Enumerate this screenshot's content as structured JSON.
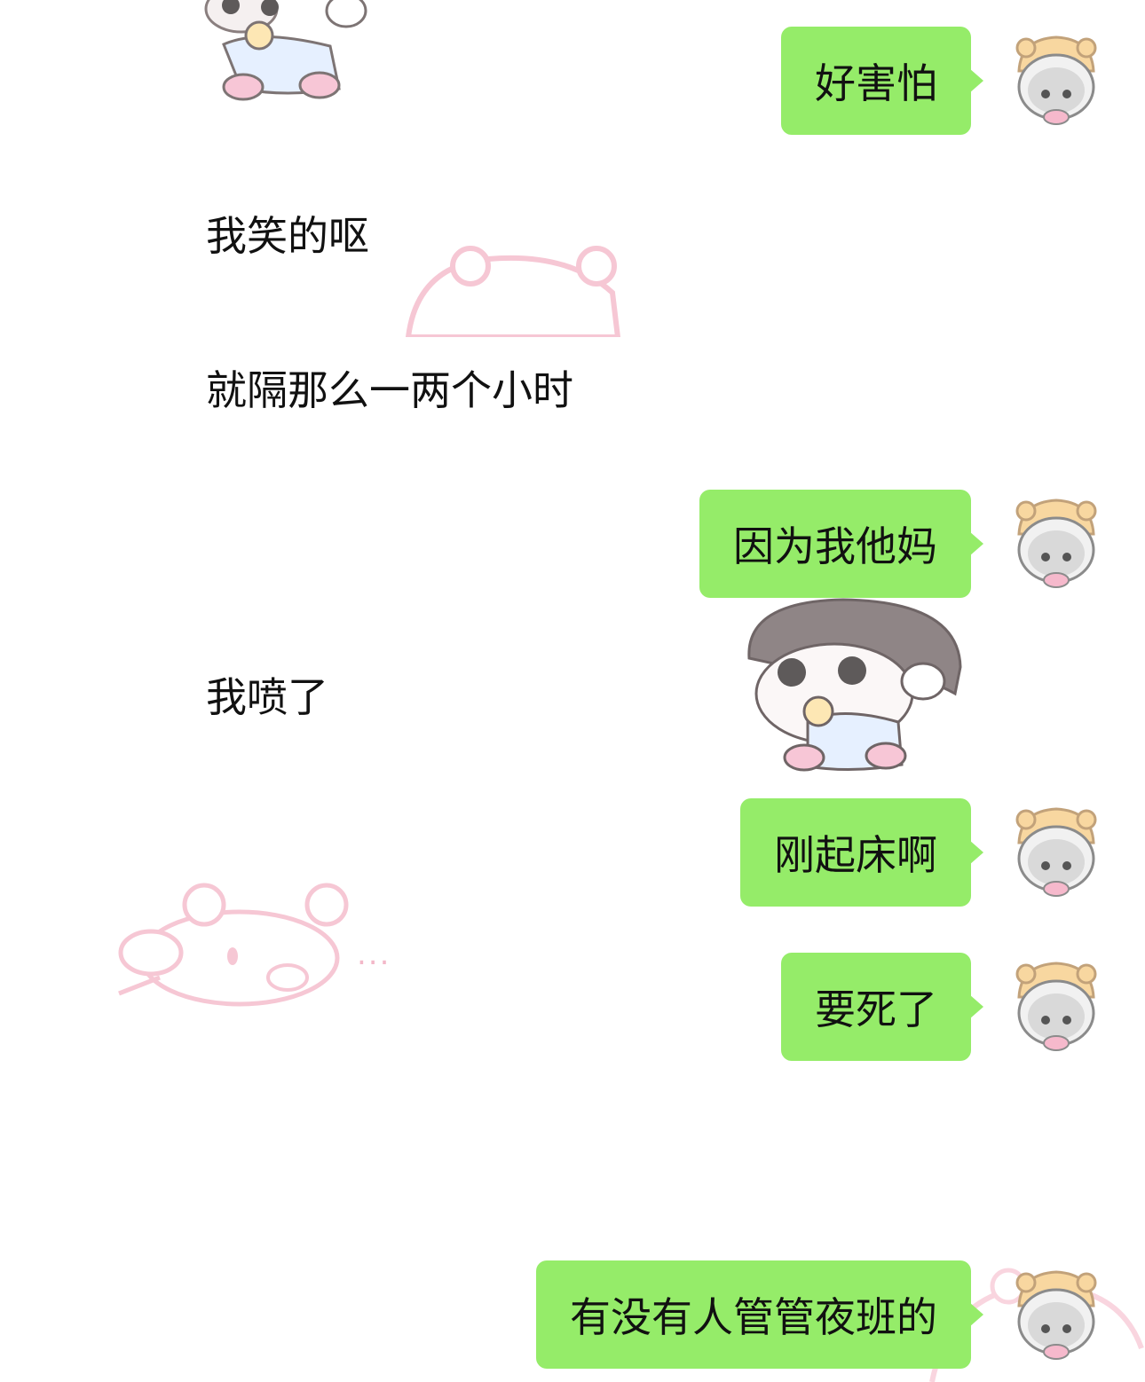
{
  "messages": [
    {
      "side": "out",
      "text": "好害怕"
    },
    {
      "side": "in",
      "text": "我笑的呕"
    },
    {
      "side": "in",
      "text": "就隔那么一两个小时"
    },
    {
      "side": "out",
      "text": "因为我他妈"
    },
    {
      "side": "in",
      "text": "我喷了"
    },
    {
      "side": "out",
      "text": "刚起床啊"
    },
    {
      "side": "out",
      "text": "要死了"
    },
    {
      "side": "out",
      "text": "有没有人管管夜班的"
    }
  ],
  "stickers": [
    {
      "name": "baby-boy-sticker",
      "text": ""
    },
    {
      "name": "pink-bear-lying-sticker",
      "text": "..."
    }
  ],
  "colors": {
    "outgoing_bubble": "#95ec69",
    "text": "#111111",
    "background": "#ffffff"
  },
  "icons": {
    "avatar": "hamster-hood-girl-avatar-icon"
  }
}
